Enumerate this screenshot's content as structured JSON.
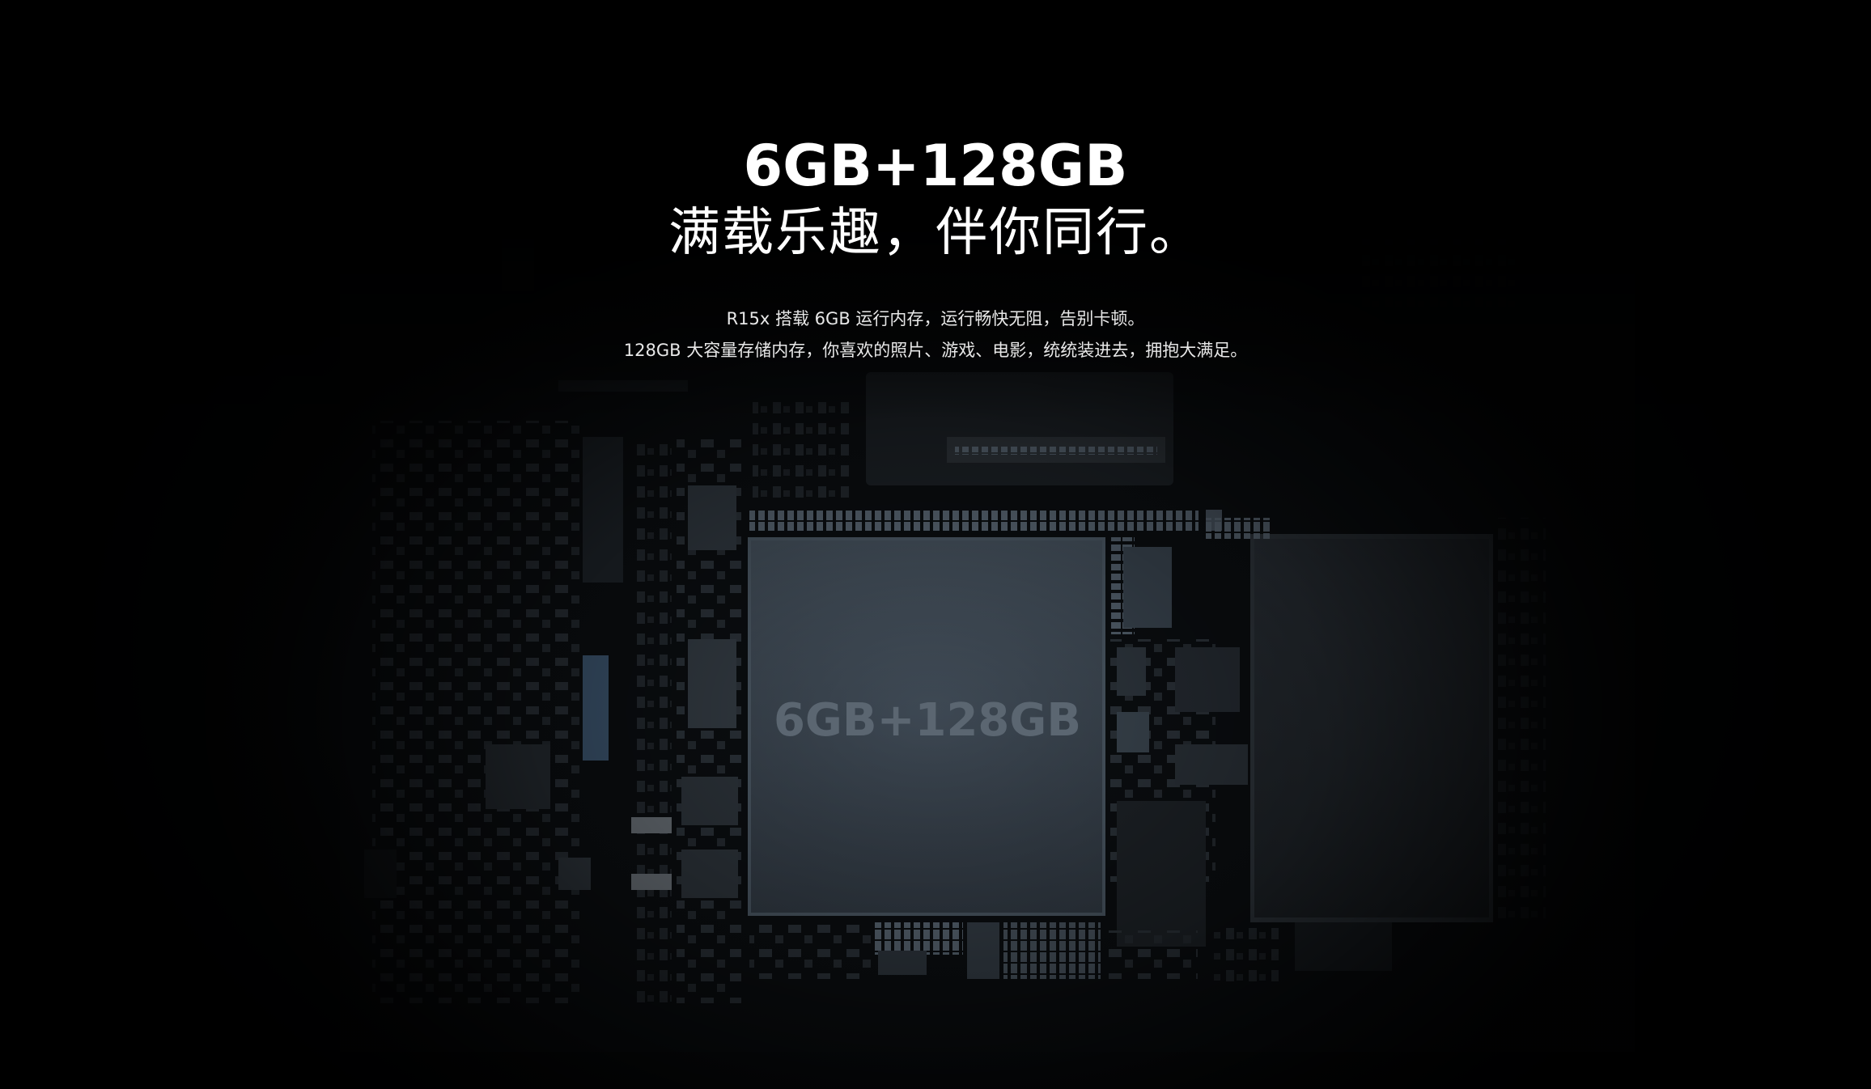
{
  "headline": {
    "line1": "6GB+128GB",
    "line2": "满载乐趣，伴你同行。"
  },
  "description": {
    "line1": "R15x 搭载 6GB 运行内存，运行畅快无阻，告别卡顿。",
    "line2": "128GB 大容量存储内存，你喜欢的照片、游戏、电影，统统装进去，拥抱大满足。"
  },
  "chip": {
    "label": "6GB+128GB"
  },
  "colors": {
    "background": "#000000",
    "text": "#ffffff",
    "chip_face": "#3a4550",
    "chip_label": "#5b6671"
  }
}
